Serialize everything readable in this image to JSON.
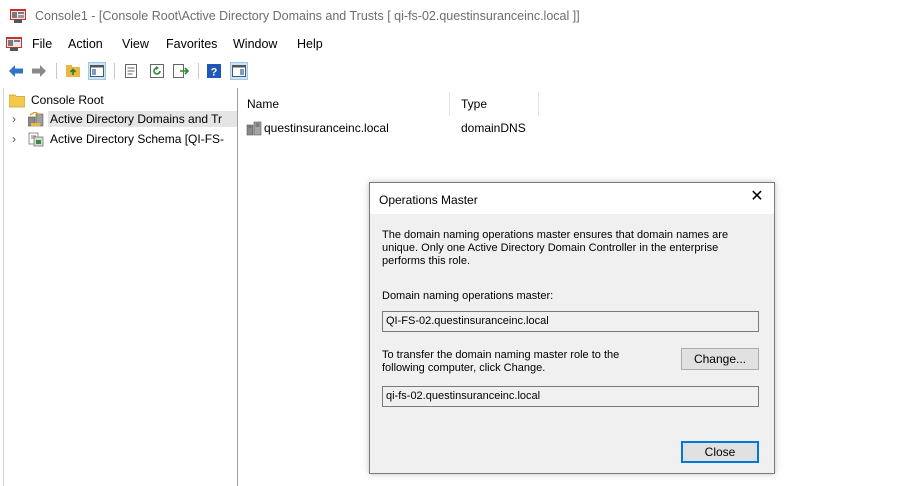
{
  "window": {
    "title": "Console1 - [Console Root\\Active Directory Domains and Trusts [ qi-fs-02.questinsuranceinc.local ]]"
  },
  "menu": {
    "items": [
      "File",
      "Action",
      "View",
      "Favorites",
      "Window",
      "Help"
    ]
  },
  "toolbar": {
    "icons": [
      "back-icon",
      "forward-icon",
      "up-folder-icon",
      "show-hide-tree-icon",
      "properties-icon",
      "refresh-icon",
      "export-list-icon",
      "help-icon",
      "show-hide-action-pane-icon"
    ]
  },
  "tree": {
    "root_label": "Console Root",
    "items": [
      {
        "label": "Active Directory Domains and Tr",
        "icon": "domains-trusts-icon",
        "selected": true
      },
      {
        "label": "Active Directory Schema [QI-FS-",
        "icon": "schema-icon",
        "selected": false
      }
    ]
  },
  "list": {
    "columns": [
      "Name",
      "Type"
    ],
    "rows": [
      {
        "name": "questinsuranceinc.local",
        "type": "domainDNS"
      }
    ]
  },
  "dialog": {
    "title": "Operations Master",
    "description": "The domain naming operations master ensures that domain names are unique. Only one Active Directory Domain Controller in the enterprise performs this role.",
    "master_label": "Domain naming operations master:",
    "master_value": "QI-FS-02.questinsuranceinc.local",
    "transfer_label": "To transfer the domain naming master role to the following computer, click Change.",
    "change_button": "Change...",
    "target_value": "qi-fs-02.questinsuranceinc.local",
    "close_button": "Close"
  },
  "colors": {
    "accent": "#0078d7",
    "selected_row": "#e5e5e5",
    "dialog_bg": "#f0f0f0"
  }
}
